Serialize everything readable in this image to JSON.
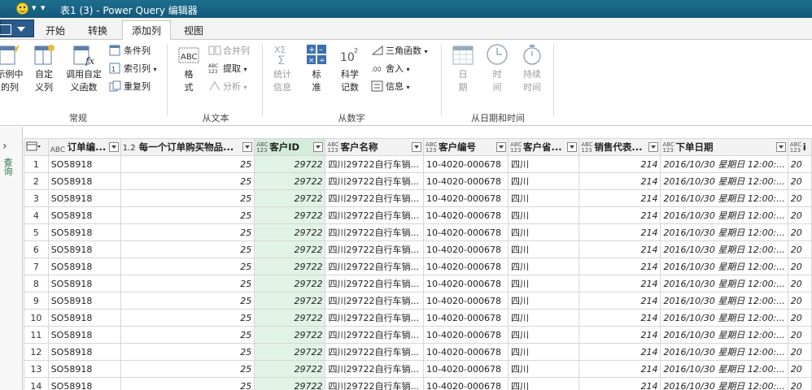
{
  "window": {
    "title": "表1 (3) - Power Query 编辑器"
  },
  "tabs": [
    {
      "label": "开始",
      "active": false
    },
    {
      "label": "转换",
      "active": false
    },
    {
      "label": "添加列",
      "active": true
    },
    {
      "label": "视图",
      "active": false
    }
  ],
  "ribbon": {
    "general": {
      "label": "常规",
      "example_col": "示例中\n的列",
      "custom_col": "自定\n义列",
      "invoke_fn": "调用自定\n义函数",
      "conditional": "条件列",
      "index": "索引列",
      "duplicate": "重复列"
    },
    "text": {
      "label": "从文本",
      "format": "格\n式",
      "merge": "合并列",
      "extract": "提取",
      "parse": "分析"
    },
    "number": {
      "label": "从数字",
      "stats": "统计\n信息",
      "standard": "标\n准",
      "scientific": "科学\n记数",
      "trig": "三角函数",
      "rounding": "舍入",
      "info": "信息"
    },
    "datetime": {
      "label": "从日期和时间",
      "date": "日\n期",
      "time": "时\n间",
      "duration": "持续\n时间"
    }
  },
  "left_pane": {
    "label": "查询"
  },
  "table": {
    "columns": [
      {
        "type": "ABC",
        "name": "订单编..."
      },
      {
        "type": "1.2",
        "name": "每一个订单购买物品..."
      },
      {
        "type": "ABC\n123",
        "name": "客户ID"
      },
      {
        "type": "ABC\n123",
        "name": "客户名称"
      },
      {
        "type": "ABC\n123",
        "name": "客户编号"
      },
      {
        "type": "ABC\n123",
        "name": "客户省..."
      },
      {
        "type": "ABC\n123",
        "name": "销售代表..."
      },
      {
        "type": "ABC\n123",
        "name": "下单日期"
      },
      {
        "type": "ABC\n123",
        "name": "i"
      }
    ],
    "rows": [
      [
        "1",
        "SO58918",
        "25",
        "29722",
        "四川29722自行车销...",
        "10-4020-000678",
        "四川",
        "214",
        "2016/10/30 星期日 12:00:...",
        "20"
      ],
      [
        "2",
        "SO58918",
        "25",
        "29722",
        "四川29722自行车销...",
        "10-4020-000678",
        "四川",
        "214",
        "2016/10/30 星期日 12:00:...",
        "20"
      ],
      [
        "3",
        "SO58918",
        "25",
        "29722",
        "四川29722自行车销...",
        "10-4020-000678",
        "四川",
        "214",
        "2016/10/30 星期日 12:00:...",
        "20"
      ],
      [
        "4",
        "SO58918",
        "25",
        "29722",
        "四川29722自行车销...",
        "10-4020-000678",
        "四川",
        "214",
        "2016/10/30 星期日 12:00:...",
        "20"
      ],
      [
        "5",
        "SO58918",
        "25",
        "29722",
        "四川29722自行车销...",
        "10-4020-000678",
        "四川",
        "214",
        "2016/10/30 星期日 12:00:...",
        "20"
      ],
      [
        "6",
        "SO58918",
        "25",
        "29722",
        "四川29722自行车销...",
        "10-4020-000678",
        "四川",
        "214",
        "2016/10/30 星期日 12:00:...",
        "20"
      ],
      [
        "7",
        "SO58918",
        "25",
        "29722",
        "四川29722自行车销...",
        "10-4020-000678",
        "四川",
        "214",
        "2016/10/30 星期日 12:00:...",
        "20"
      ],
      [
        "8",
        "SO58918",
        "25",
        "29722",
        "四川29722自行车销...",
        "10-4020-000678",
        "四川",
        "214",
        "2016/10/30 星期日 12:00:...",
        "20"
      ],
      [
        "9",
        "SO58918",
        "25",
        "29722",
        "四川29722自行车销...",
        "10-4020-000678",
        "四川",
        "214",
        "2016/10/30 星期日 12:00:...",
        "20"
      ],
      [
        "10",
        "SO58918",
        "25",
        "29722",
        "四川29722自行车销...",
        "10-4020-000678",
        "四川",
        "214",
        "2016/10/30 星期日 12:00:...",
        "20"
      ],
      [
        "11",
        "SO58918",
        "25",
        "29722",
        "四川29722自行车销...",
        "10-4020-000678",
        "四川",
        "214",
        "2016/10/30 星期日 12:00:...",
        "20"
      ],
      [
        "12",
        "SO58918",
        "25",
        "29722",
        "四川29722自行车销...",
        "10-4020-000678",
        "四川",
        "214",
        "2016/10/30 星期日 12:00:...",
        "20"
      ],
      [
        "13",
        "SO58918",
        "25",
        "29722",
        "四川29722自行车销...",
        "10-4020-000678",
        "四川",
        "214",
        "2016/10/30 星期日 12:00:...",
        "20"
      ],
      [
        "14",
        "SO58918",
        "25",
        "29722",
        "四川29722自行车销...",
        "10-4020-000678",
        "四川",
        "214",
        "2016/10/30 星期日 12:00:...",
        "20"
      ]
    ]
  },
  "colors": {
    "accent": "#217346",
    "title_bar": "#14597a",
    "selected_column": "#e1f3e6"
  }
}
